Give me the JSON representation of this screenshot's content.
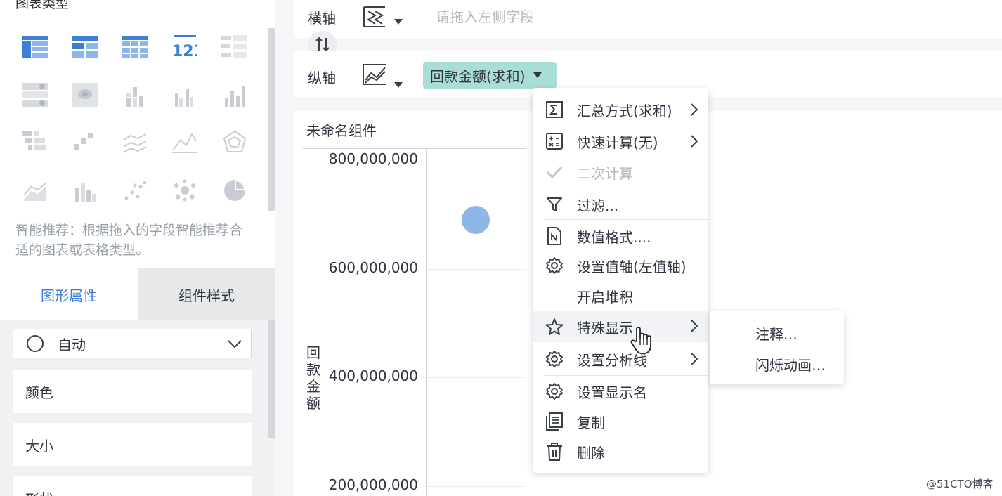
{
  "left_panel": {
    "header": "图表类型",
    "chart_type_icons": [
      "table-icon",
      "cross-table-icon",
      "detail-table-icon",
      "kpi-number-icon",
      "kpi-list-icon",
      "filter-table-icon",
      "heat-map-icon",
      "stacked-bar-icon",
      "grouped-bar-icon",
      "column-icon",
      "comparison-bar-icon",
      "waterfall-icon",
      "multi-line-icon",
      "area-line-icon",
      "radar-icon",
      "area-chart-icon",
      "bar-line-combo-icon",
      "scatter-icon",
      "bubble-icon",
      "pie-icon"
    ],
    "hint": "智能推荐：根据拖入的字段智能推荐合适的图表或表格类型。",
    "tabs": {
      "graph_props": "图形属性",
      "component_style": "组件样式"
    },
    "mark_type": "自动",
    "properties": [
      "颜色",
      "大小",
      "形状"
    ]
  },
  "axes": {
    "x_label": "横轴",
    "x_placeholder": "请拖入左侧字段",
    "y_label": "纵轴",
    "y_field": "回款金额(求和)"
  },
  "chart": {
    "component_title": "未命名组件"
  },
  "chart_data": {
    "type": "scatter",
    "title": "未命名组件",
    "ylabel": "回款金额",
    "xlabel": "",
    "y_ticks": [
      "800,000,000",
      "600,000,000",
      "400,000,000",
      "200,000,000"
    ],
    "points": [
      {
        "y": 690000000
      }
    ],
    "ylim": [
      200000000,
      800000000
    ],
    "grid": true
  },
  "context_menu": {
    "items": [
      {
        "label": "汇总方式(求和)",
        "icon": "sigma-icon",
        "submenu": true,
        "disabled": false
      },
      {
        "label": "快速计算(无)",
        "icon": "calculator-icon",
        "submenu": true,
        "disabled": false
      },
      {
        "label": "二次计算",
        "icon": "check-icon",
        "submenu": false,
        "disabled": true
      },
      {
        "label": "过滤...",
        "icon": "filter-icon",
        "submenu": false,
        "disabled": false
      },
      {
        "label": "数值格式....",
        "icon": "number-format-icon",
        "submenu": false,
        "disabled": false
      },
      {
        "label": "设置值轴(左值轴)",
        "icon": "gear-icon",
        "submenu": false,
        "disabled": false
      },
      {
        "label": "开启堆积",
        "icon": "",
        "submenu": false,
        "disabled": false
      },
      {
        "label": "特殊显示",
        "icon": "star-icon",
        "submenu": true,
        "disabled": false
      },
      {
        "label": "设置分析线",
        "icon": "gear-icon",
        "submenu": true,
        "disabled": false
      },
      {
        "label": "设置显示名",
        "icon": "gear-icon",
        "submenu": false,
        "disabled": false
      },
      {
        "label": "复制",
        "icon": "copy-icon",
        "submenu": false,
        "disabled": false
      },
      {
        "label": "删除",
        "icon": "trash-icon",
        "submenu": false,
        "disabled": false
      }
    ],
    "submenu_items": [
      "注释…",
      "闪烁动画…"
    ]
  },
  "watermark": "@51CTO博客",
  "colors": {
    "accent": "#3a7dd9",
    "pill": "#a9ded7",
    "dot": "#8fb6e8",
    "icon_blue": "#3d7fd8",
    "icon_gray": "#c9cdd3"
  }
}
